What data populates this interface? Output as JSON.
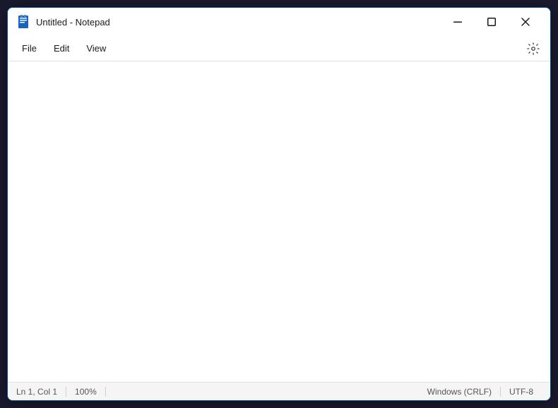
{
  "window": {
    "title": "Untitled - Notepad",
    "app_icon_label": "Notepad icon"
  },
  "titlebar": {
    "minimize_label": "minimize",
    "maximize_label": "maximize",
    "close_label": "close"
  },
  "menubar": {
    "items": [
      {
        "label": "File",
        "id": "file"
      },
      {
        "label": "Edit",
        "id": "edit"
      },
      {
        "label": "View",
        "id": "view"
      }
    ],
    "settings_label": "Settings"
  },
  "editor": {
    "content": "",
    "placeholder": ""
  },
  "statusbar": {
    "position": "Ln 1, Col 1",
    "zoom": "100%",
    "line_ending": "Windows (CRLF)",
    "encoding": "UTF-8"
  }
}
